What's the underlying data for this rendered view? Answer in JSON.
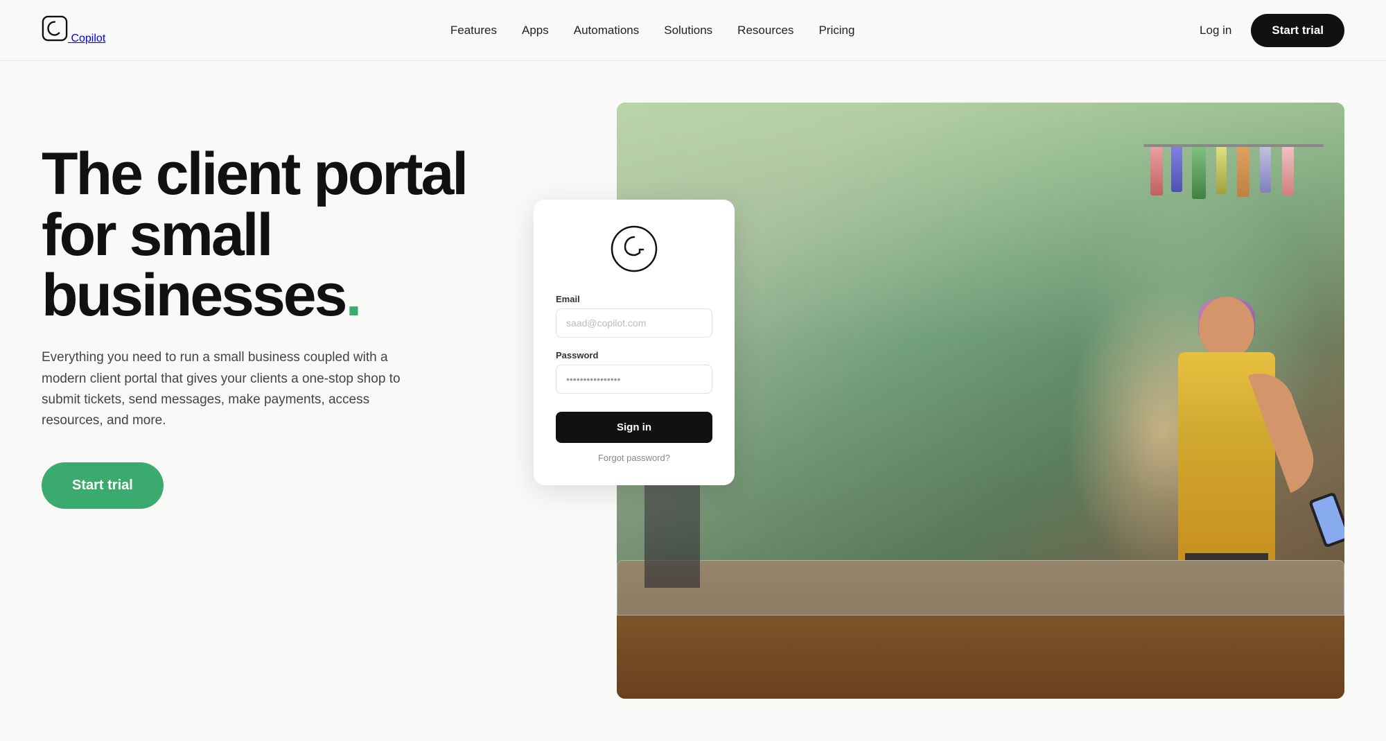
{
  "brand": {
    "name": "Copilot",
    "logo_symbol": "(C)"
  },
  "nav": {
    "links": [
      {
        "label": "Features",
        "id": "features"
      },
      {
        "label": "Apps",
        "id": "apps"
      },
      {
        "label": "Automations",
        "id": "automations"
      },
      {
        "label": "Solutions",
        "id": "solutions"
      },
      {
        "label": "Resources",
        "id": "resources"
      },
      {
        "label": "Pricing",
        "id": "pricing"
      }
    ],
    "login_label": "Log in",
    "trial_label": "Start trial"
  },
  "hero": {
    "title_line1": "The client portal",
    "title_line2": "for small",
    "title_line3": "businesses",
    "title_dot": ".",
    "subtitle": "Everything you need to run a small business coupled with a modern client portal that gives your clients a one-stop shop to submit tickets, send messages, make payments, access resources, and more.",
    "cta_label": "Start trial"
  },
  "portal_card": {
    "email_label": "Email",
    "email_placeholder": "saad@copilot.com",
    "password_label": "Password",
    "password_value": "••••••••••••••••",
    "sign_in_label": "Sign in",
    "forgot_label": "Forgot password?"
  }
}
